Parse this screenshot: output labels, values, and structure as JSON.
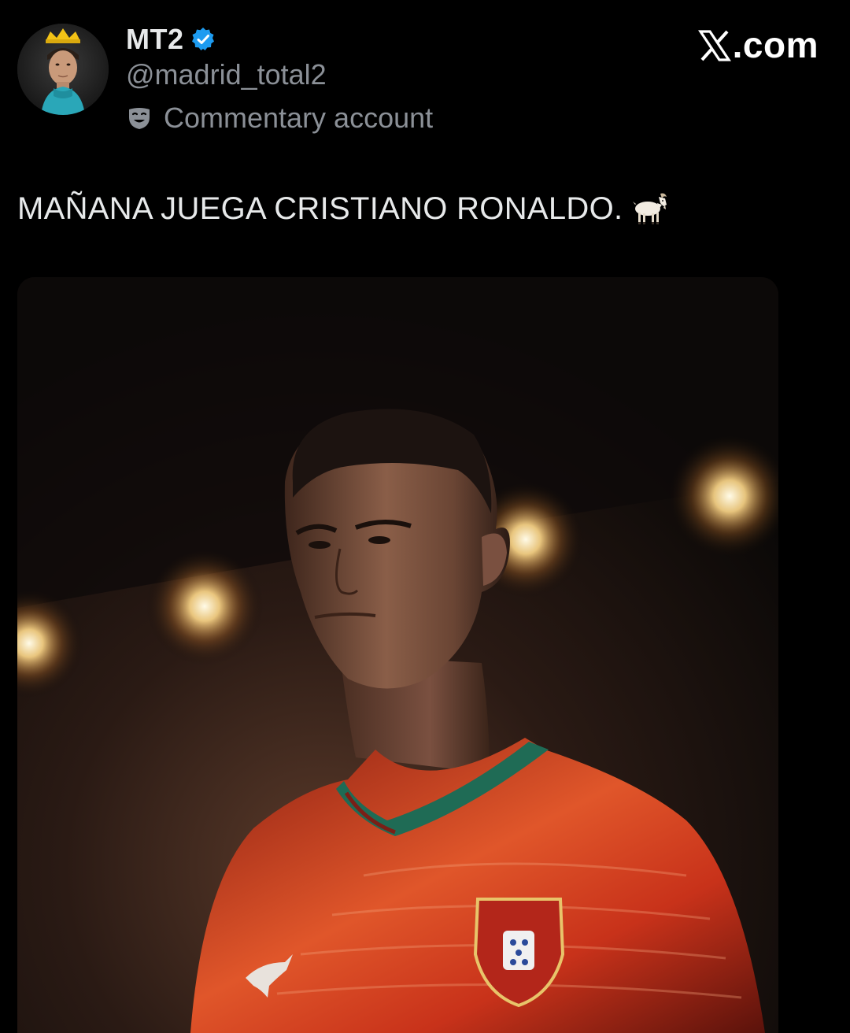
{
  "author": {
    "display_name": "MT2",
    "handle": "@madrid_total2",
    "account_label": "Commentary account",
    "verified": true,
    "avatar_icon": "profile-photo-crowned"
  },
  "brand": {
    "text": ".com",
    "logo_icon": "x-logo-icon"
  },
  "tweet": {
    "text": "MAÑANA JUEGA CRISTIANO RONALDO.",
    "emoji_icon": "goat-icon"
  },
  "media": {
    "icon": "player-photo"
  },
  "colors": {
    "background": "#000000",
    "text_primary": "#e7e9ea",
    "text_secondary": "#8b9097",
    "verified_blue": "#1d9bf0",
    "jersey_red": "#c8321a",
    "trim_green": "#1f6b55"
  }
}
